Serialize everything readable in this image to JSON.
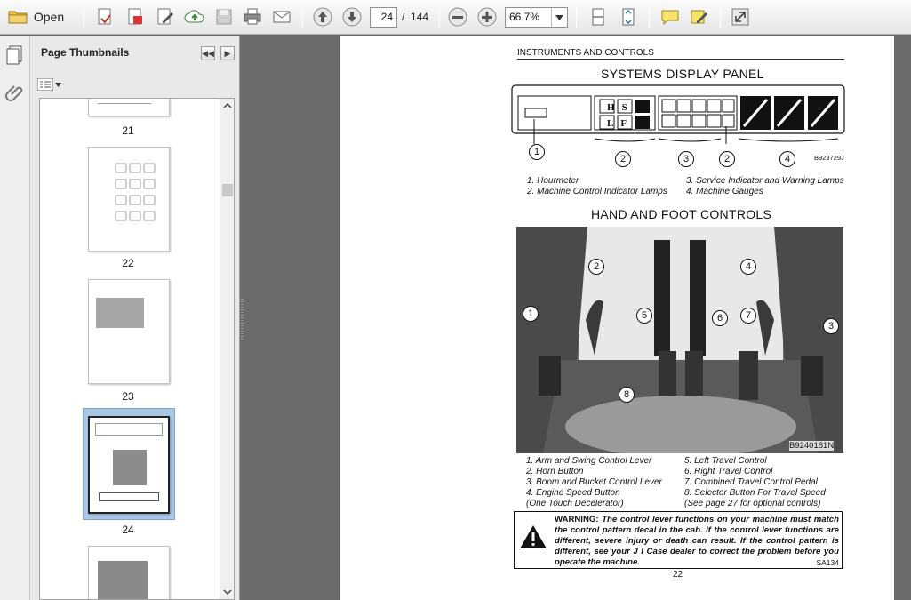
{
  "toolbar": {
    "open_label": "Open",
    "page_current": "24",
    "page_separator": "/",
    "page_total": "144",
    "zoom": "66.7%",
    "icons": [
      "folder-icon",
      "create-pdf-icon",
      "print-pdf-icon",
      "edit-icon",
      "upload-icon",
      "save-icon",
      "printer-icon",
      "email-icon",
      "page-up-icon",
      "page-down-icon",
      "zoom-out-icon",
      "zoom-in-icon",
      "fit-width-icon",
      "fit-page-icon",
      "comment-icon",
      "sign-icon",
      "expand-icon"
    ]
  },
  "panel": {
    "title": "Page Thumbnails",
    "thumbnails": [
      {
        "label": "21"
      },
      {
        "label": "22"
      },
      {
        "label": "23"
      },
      {
        "label": "24"
      },
      {
        "label": ""
      }
    ]
  },
  "document": {
    "section": "INSTRUMENTS AND CONTROLS",
    "title1": "SYSTEMS DISPLAY PANEL",
    "diagram1_code": "B923729J",
    "diagram1_callouts": [
      "1",
      "2",
      "3",
      "2",
      "4"
    ],
    "panel_letters": [
      "H",
      "S",
      "L",
      "F"
    ],
    "legend1": {
      "left": [
        "1. Hourmeter",
        "2. Machine Control Indicator Lamps"
      ],
      "right": [
        "3. Service Indicator and Warning Lamps",
        "4. Machine Gauges"
      ]
    },
    "title2": "HAND AND FOOT CONTROLS",
    "photo_code": "B9240181N",
    "photo_callouts": [
      "1",
      "2",
      "3",
      "4",
      "5",
      "6",
      "7",
      "8"
    ],
    "legend2": {
      "left": [
        "1. Arm and Swing Control Lever",
        "2. Horn Button",
        "3. Boom and Bucket Control Lever",
        "4. Engine Speed Button",
        "(One Touch Decelerator)"
      ],
      "right": [
        "5. Left Travel Control",
        "6. Right Travel Control",
        "7. Combined Travel Control Pedal",
        "8. Selector Button For Travel Speed",
        "(See page 27 for optional controls)"
      ]
    },
    "warning": {
      "lead": "WARNING:",
      "text": " The control lever functions on your machine must match the control pattern decal in the cab. If the control lever functions are different, severe injury or death can result. If the control pattern is different, see your J I Case dealer to correct the problem before you operate the machine.",
      "code": "SA134"
    },
    "page_number": "22"
  },
  "colors": {
    "toolbar_bg": "#efefef",
    "workspace": "#6b6b6b",
    "selection": "#a9c7e4"
  }
}
